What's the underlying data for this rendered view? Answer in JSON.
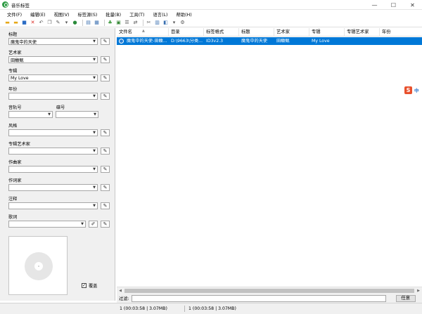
{
  "window": {
    "title": "音乐标签",
    "minimize_glyph": "—",
    "maximize_glyph": "☐",
    "close_glyph": "✕"
  },
  "menu": [
    "文件(F)",
    "编辑(E)",
    "视图(V)",
    "标签源(S)",
    "批量(B)",
    "工具(T)",
    "语言(L)",
    "帮助(H)"
  ],
  "toolbar_icons": [
    "folder-open-icon",
    "folder-add-icon",
    "save-icon",
    "delete-icon",
    "undo-icon",
    "copy-icon",
    "wand-icon",
    "tag-source-icon",
    "globe-icon",
    "list-view-icon",
    "grid-view-icon",
    "leaf-icon",
    "export-icon",
    "playlist-icon",
    "convert-icon",
    "tools-icon",
    "cover-icon",
    "rename-icon",
    "rename-dropdown-icon",
    "settings-icon"
  ],
  "fields": {
    "title": {
      "label": "标题",
      "value": "魔鬼中的天使"
    },
    "artist": {
      "label": "艺术家",
      "value": "田馥甄"
    },
    "album": {
      "label": "专辑",
      "value": "My Love"
    },
    "year": {
      "label": "年份",
      "value": ""
    },
    "track": {
      "label": "音轨号",
      "value": ""
    },
    "disc": {
      "label": "碟号",
      "value": ""
    },
    "genre": {
      "label": "风格",
      "value": ""
    },
    "album_artist": {
      "label": "专辑艺术家",
      "value": ""
    },
    "composer": {
      "label": "作曲家",
      "value": ""
    },
    "lyricist": {
      "label": "作词家",
      "value": ""
    },
    "comment": {
      "label": "注释",
      "value": ""
    },
    "lyrics": {
      "label": "歌词",
      "value": ""
    }
  },
  "cover": {
    "overwrite_label": "覆盖",
    "overwrite_checked": "✓"
  },
  "file_list": {
    "columns": [
      "文件名",
      "目录",
      "标签格式",
      "标题",
      "艺术家",
      "专辑",
      "专辑艺术家",
      "年份"
    ],
    "rows": [
      {
        "filename": "魔鬼中的天使-田馥...",
        "directory": "D:\\9663\\分类...",
        "tag_format": "ID3v2.3",
        "title": "魔鬼中的天使",
        "artist": "田馥甄",
        "album": "My Love",
        "album_artist": "",
        "year": ""
      }
    ]
  },
  "filter": {
    "label": "过滤:",
    "value": "",
    "mode_button": "任意"
  },
  "status": {
    "left": "1 (00:03:58 | 3.07MB)",
    "right": "1 (00:03:58 | 3.07MB)"
  },
  "ime": {
    "logo": "S",
    "mode": "中"
  }
}
